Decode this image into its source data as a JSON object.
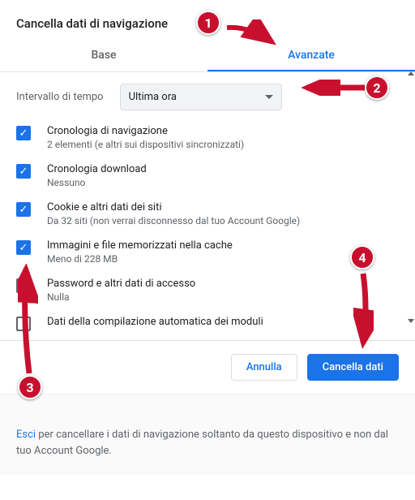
{
  "title": "Cancella dati di navigazione",
  "tabs": {
    "basic": "Base",
    "advanced": "Avanzate"
  },
  "time": {
    "label": "Intervallo di tempo",
    "value": "Ultima ora"
  },
  "items": [
    {
      "label": "Cronologia di navigazione",
      "sub": "2 elementi (e altri sui dispositivi sincronizzati)",
      "checked": true
    },
    {
      "label": "Cronologia download",
      "sub": "Nessuno",
      "checked": true
    },
    {
      "label": "Cookie e altri dati dei siti",
      "sub": "Da 32 siti (non verrai disconnesso dal tuo Account Google)",
      "checked": true
    },
    {
      "label": "Immagini e file memorizzati nella cache",
      "sub": "Meno di 228 MB",
      "checked": true
    },
    {
      "label": "Password e altri dati di accesso",
      "sub": "Nulla",
      "checked": false
    },
    {
      "label": "Dati della compilazione automatica dei moduli",
      "sub": "",
      "checked": false
    }
  ],
  "buttons": {
    "cancel": "Annulla",
    "confirm": "Cancella dati"
  },
  "footer": {
    "link": "Esci",
    "text": " per cancellare i dati di navigazione soltanto da questo dispositivo e non dal tuo Account Google."
  },
  "callouts": {
    "1": "1",
    "2": "2",
    "3": "3",
    "4": "4"
  }
}
